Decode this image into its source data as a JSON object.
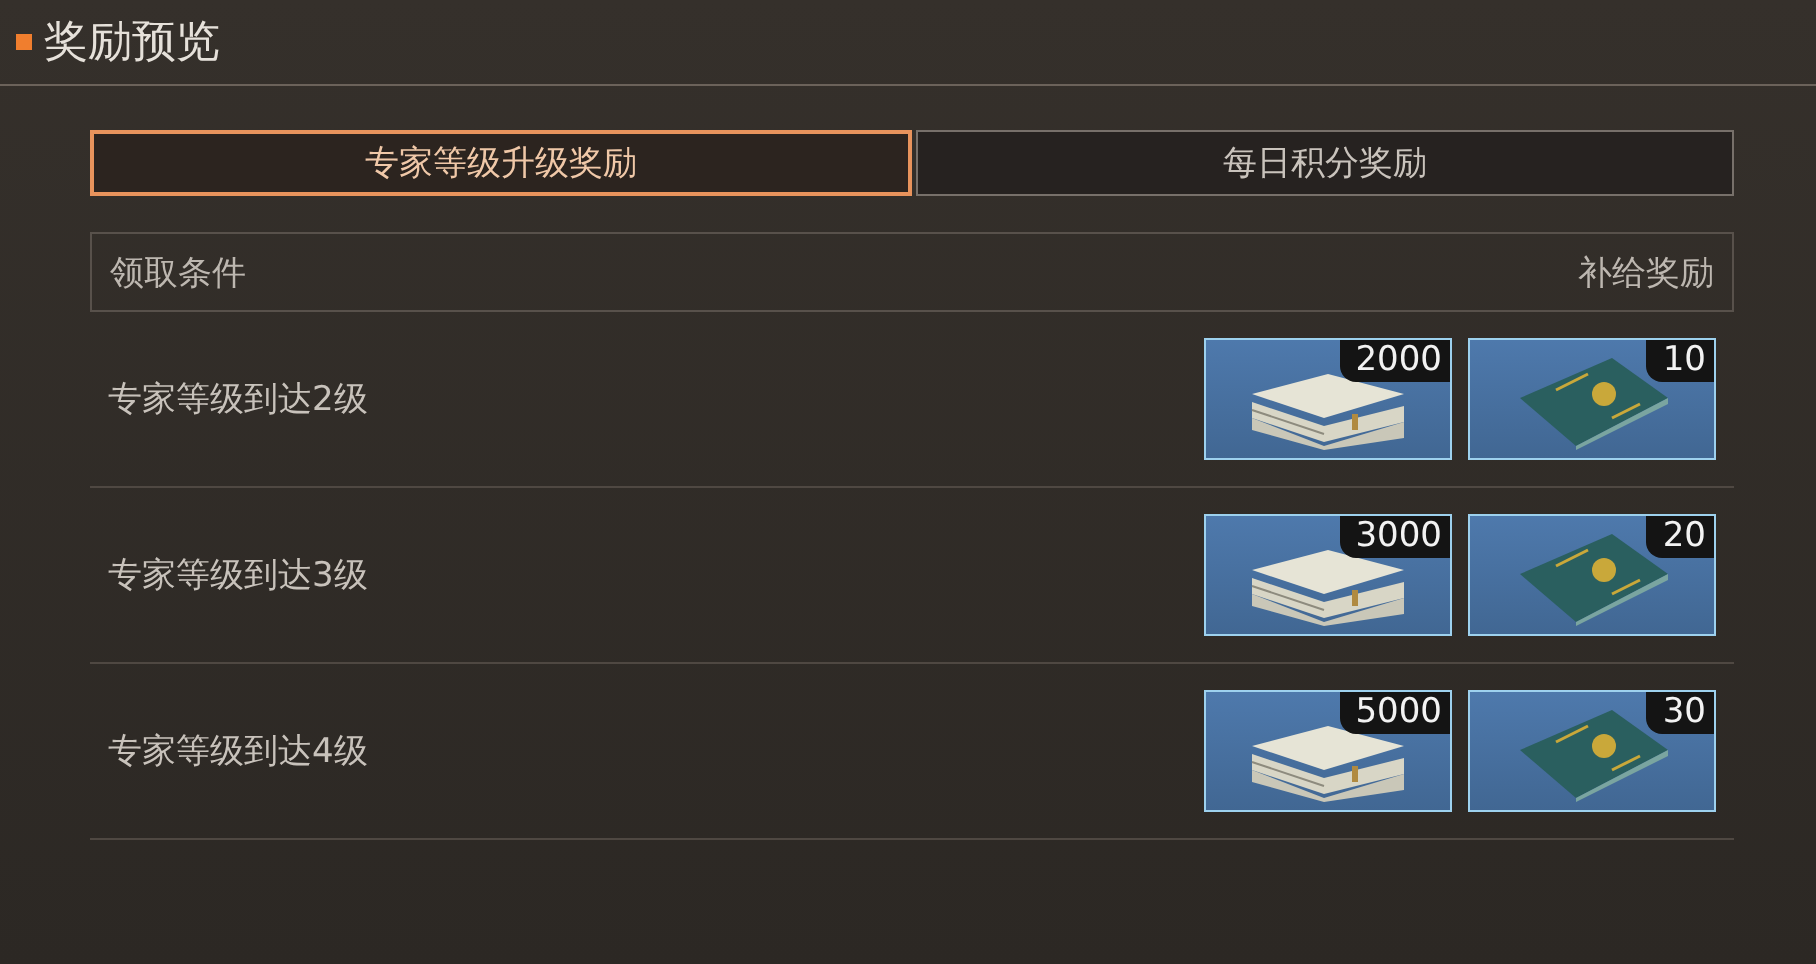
{
  "title": "奖励预览",
  "tabs": [
    {
      "label": "专家等级升级奖励",
      "selected": true
    },
    {
      "label": "每日积分奖励",
      "selected": false
    }
  ],
  "table": {
    "columns": [
      "领取条件",
      "补给奖励"
    ],
    "rows": [
      {
        "condition": "专家等级到达2级",
        "rewards": [
          {
            "kind": "cash",
            "count": "2000"
          },
          {
            "kind": "passport",
            "count": "10"
          }
        ]
      },
      {
        "condition": "专家等级到达3级",
        "rewards": [
          {
            "kind": "cash",
            "count": "3000"
          },
          {
            "kind": "passport",
            "count": "20"
          }
        ]
      },
      {
        "condition": "专家等级到达4级",
        "rewards": [
          {
            "kind": "cash",
            "count": "5000"
          },
          {
            "kind": "passport",
            "count": "30"
          }
        ]
      }
    ]
  }
}
